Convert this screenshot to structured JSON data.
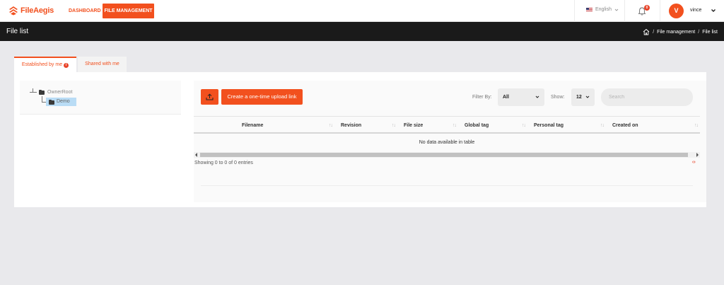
{
  "brand": {
    "name": "FileAegis",
    "accent": "#f2501e"
  },
  "nav": {
    "dashboard": "DASHBOARD",
    "file_management": "FILE MANAGEMENT"
  },
  "header": {
    "language": "English",
    "notifications_count": "0",
    "user_initial": "V",
    "username": "vince"
  },
  "page": {
    "title": "File list",
    "breadcrumb": [
      "File management",
      "File list"
    ]
  },
  "tabs": [
    {
      "label": "Established by me",
      "active": true
    },
    {
      "label": "Shared with me",
      "active": false
    }
  ],
  "tree": {
    "root": "OwnerRoot",
    "child": "Demo"
  },
  "toolbar": {
    "upload_once_label": "Create a one-time upload link",
    "filter_label": "Filter By:",
    "filter_value": "All",
    "show_label": "Show:",
    "show_value": "12",
    "search_placeholder": "Search"
  },
  "table": {
    "columns": [
      "Filename",
      "Revision",
      "File size",
      "Global tag",
      "Personal tag",
      "Created on"
    ],
    "empty_text": "No data available in table",
    "info": "Showing 0 to 0 of 0 entries"
  }
}
